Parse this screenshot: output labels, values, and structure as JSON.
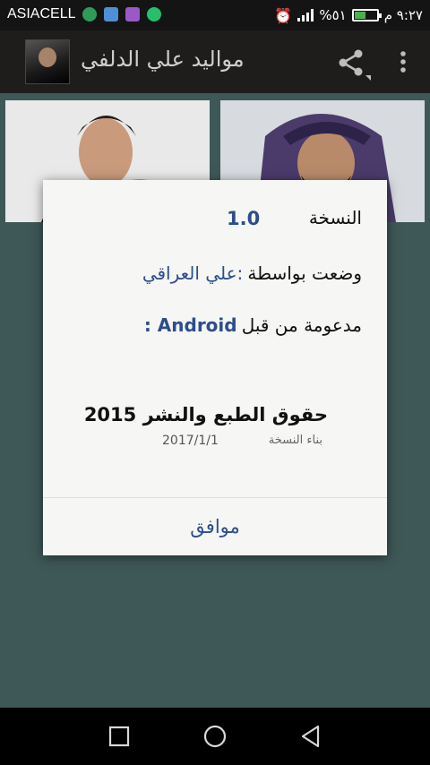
{
  "status_bar": {
    "carrier": "ASIACELL",
    "battery_percent_text": "%٥١",
    "time": "٩:٢٧ م",
    "battery_level": 0.51,
    "icons": [
      "app-notification-icon",
      "message-icon",
      "gallery-icon",
      "whatsapp-icon",
      "alarm-icon",
      "signal-icon",
      "battery-icon"
    ]
  },
  "app_bar": {
    "title": "مواليد علي الدلفي",
    "icons": [
      "share-icon",
      "overflow-menu-icon"
    ]
  },
  "dialog": {
    "version_label": "النسخة",
    "version_value": "1.0",
    "author_label": "وضعت بواسطة",
    "author_value": ":علي العراقي",
    "supported_label": "مدعومة من قبل",
    "supported_value": "Android :",
    "copyright": "حقوق الطبع والنشر 2015",
    "build_label": "بناء النسخة",
    "build_value": "2017/1/1",
    "ok_label": "موافق"
  },
  "nav_bar": {
    "icons": [
      "recent-apps-icon",
      "home-icon",
      "back-icon"
    ]
  },
  "colors": {
    "status_bar": "#141414",
    "app_bar": "#1f1c1c",
    "content_bg": "#3e5857",
    "accent": "#2b4d8c",
    "dialog_bg": "#f6f6f4"
  }
}
